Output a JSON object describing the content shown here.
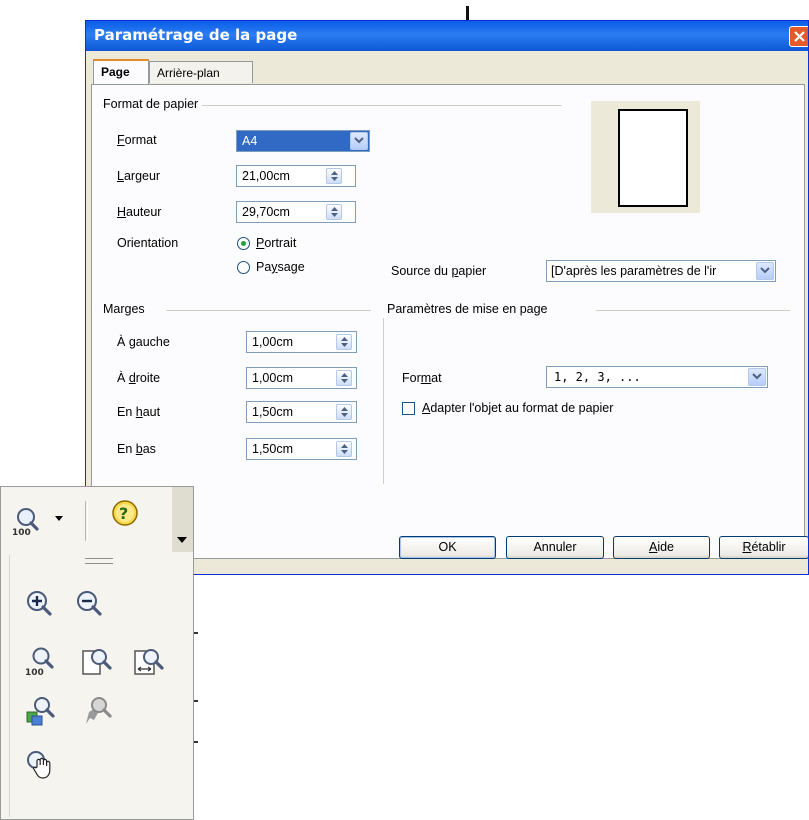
{
  "dialog": {
    "title": "Paramétrage de la page",
    "tabs": [
      {
        "label": "Page",
        "active": true
      },
      {
        "label": "Arrière-plan",
        "active": false
      }
    ],
    "paper_format": {
      "group_label": "Format de papier",
      "format": {
        "label_pre": "",
        "label_u": "F",
        "label_post": "ormat",
        "value": "A4"
      },
      "width": {
        "label_u": "L",
        "label_post": "argeur",
        "value": "21,00cm"
      },
      "height": {
        "label_u": "H",
        "label_post": "auteur",
        "value": "29,70cm"
      },
      "orientation": {
        "label": "Orientation",
        "portrait": {
          "label_u": "P",
          "label_post": "ortrait",
          "selected": true
        },
        "landscape": {
          "label_pre": "Pa",
          "label_u": "y",
          "label_post": "sage",
          "selected": false
        }
      },
      "paper_source": {
        "label_pre": "Source du ",
        "label_u": "p",
        "label_post": "apier",
        "value": "[D'après les paramètres de l'ir"
      }
    },
    "margins": {
      "group_label": "Marges",
      "left": {
        "label_pre": "À ",
        "label_u": "g",
        "label_post": "auche",
        "value": "1,00cm"
      },
      "right": {
        "label_pre": "À ",
        "label_u": "d",
        "label_post": "roite",
        "value": "1,00cm"
      },
      "top": {
        "label_pre": "En ",
        "label_u": "h",
        "label_post": "aut",
        "value": "1,50cm"
      },
      "bottom": {
        "label_pre": "En ",
        "label_u": "b",
        "label_post": "as",
        "value": "1,50cm"
      }
    },
    "layout_settings": {
      "group_label": "Paramètres de mise en page",
      "format": {
        "label_pre": "For",
        "label_u": "m",
        "label_post": "at",
        "value": "1, 2, 3, ..."
      },
      "fit_object": {
        "label_u": "A",
        "label_post": "dapter l'objet au format de papier",
        "checked": false
      }
    },
    "buttons": {
      "ok": "OK",
      "cancel": "Annuler",
      "help_u": "A",
      "help_post": "ide",
      "reset_u": "R",
      "reset_post": "établir"
    }
  },
  "zoom_toolbar": {
    "zoom_label": "100",
    "icons": [
      "zoom-100-icon",
      "help-icon",
      "zoom-in-icon",
      "zoom-out-icon",
      "zoom-100-icon",
      "zoom-page-icon",
      "zoom-page-width-icon",
      "zoom-optimal-icon",
      "object-zoom-icon",
      "shift-hand-icon"
    ]
  }
}
